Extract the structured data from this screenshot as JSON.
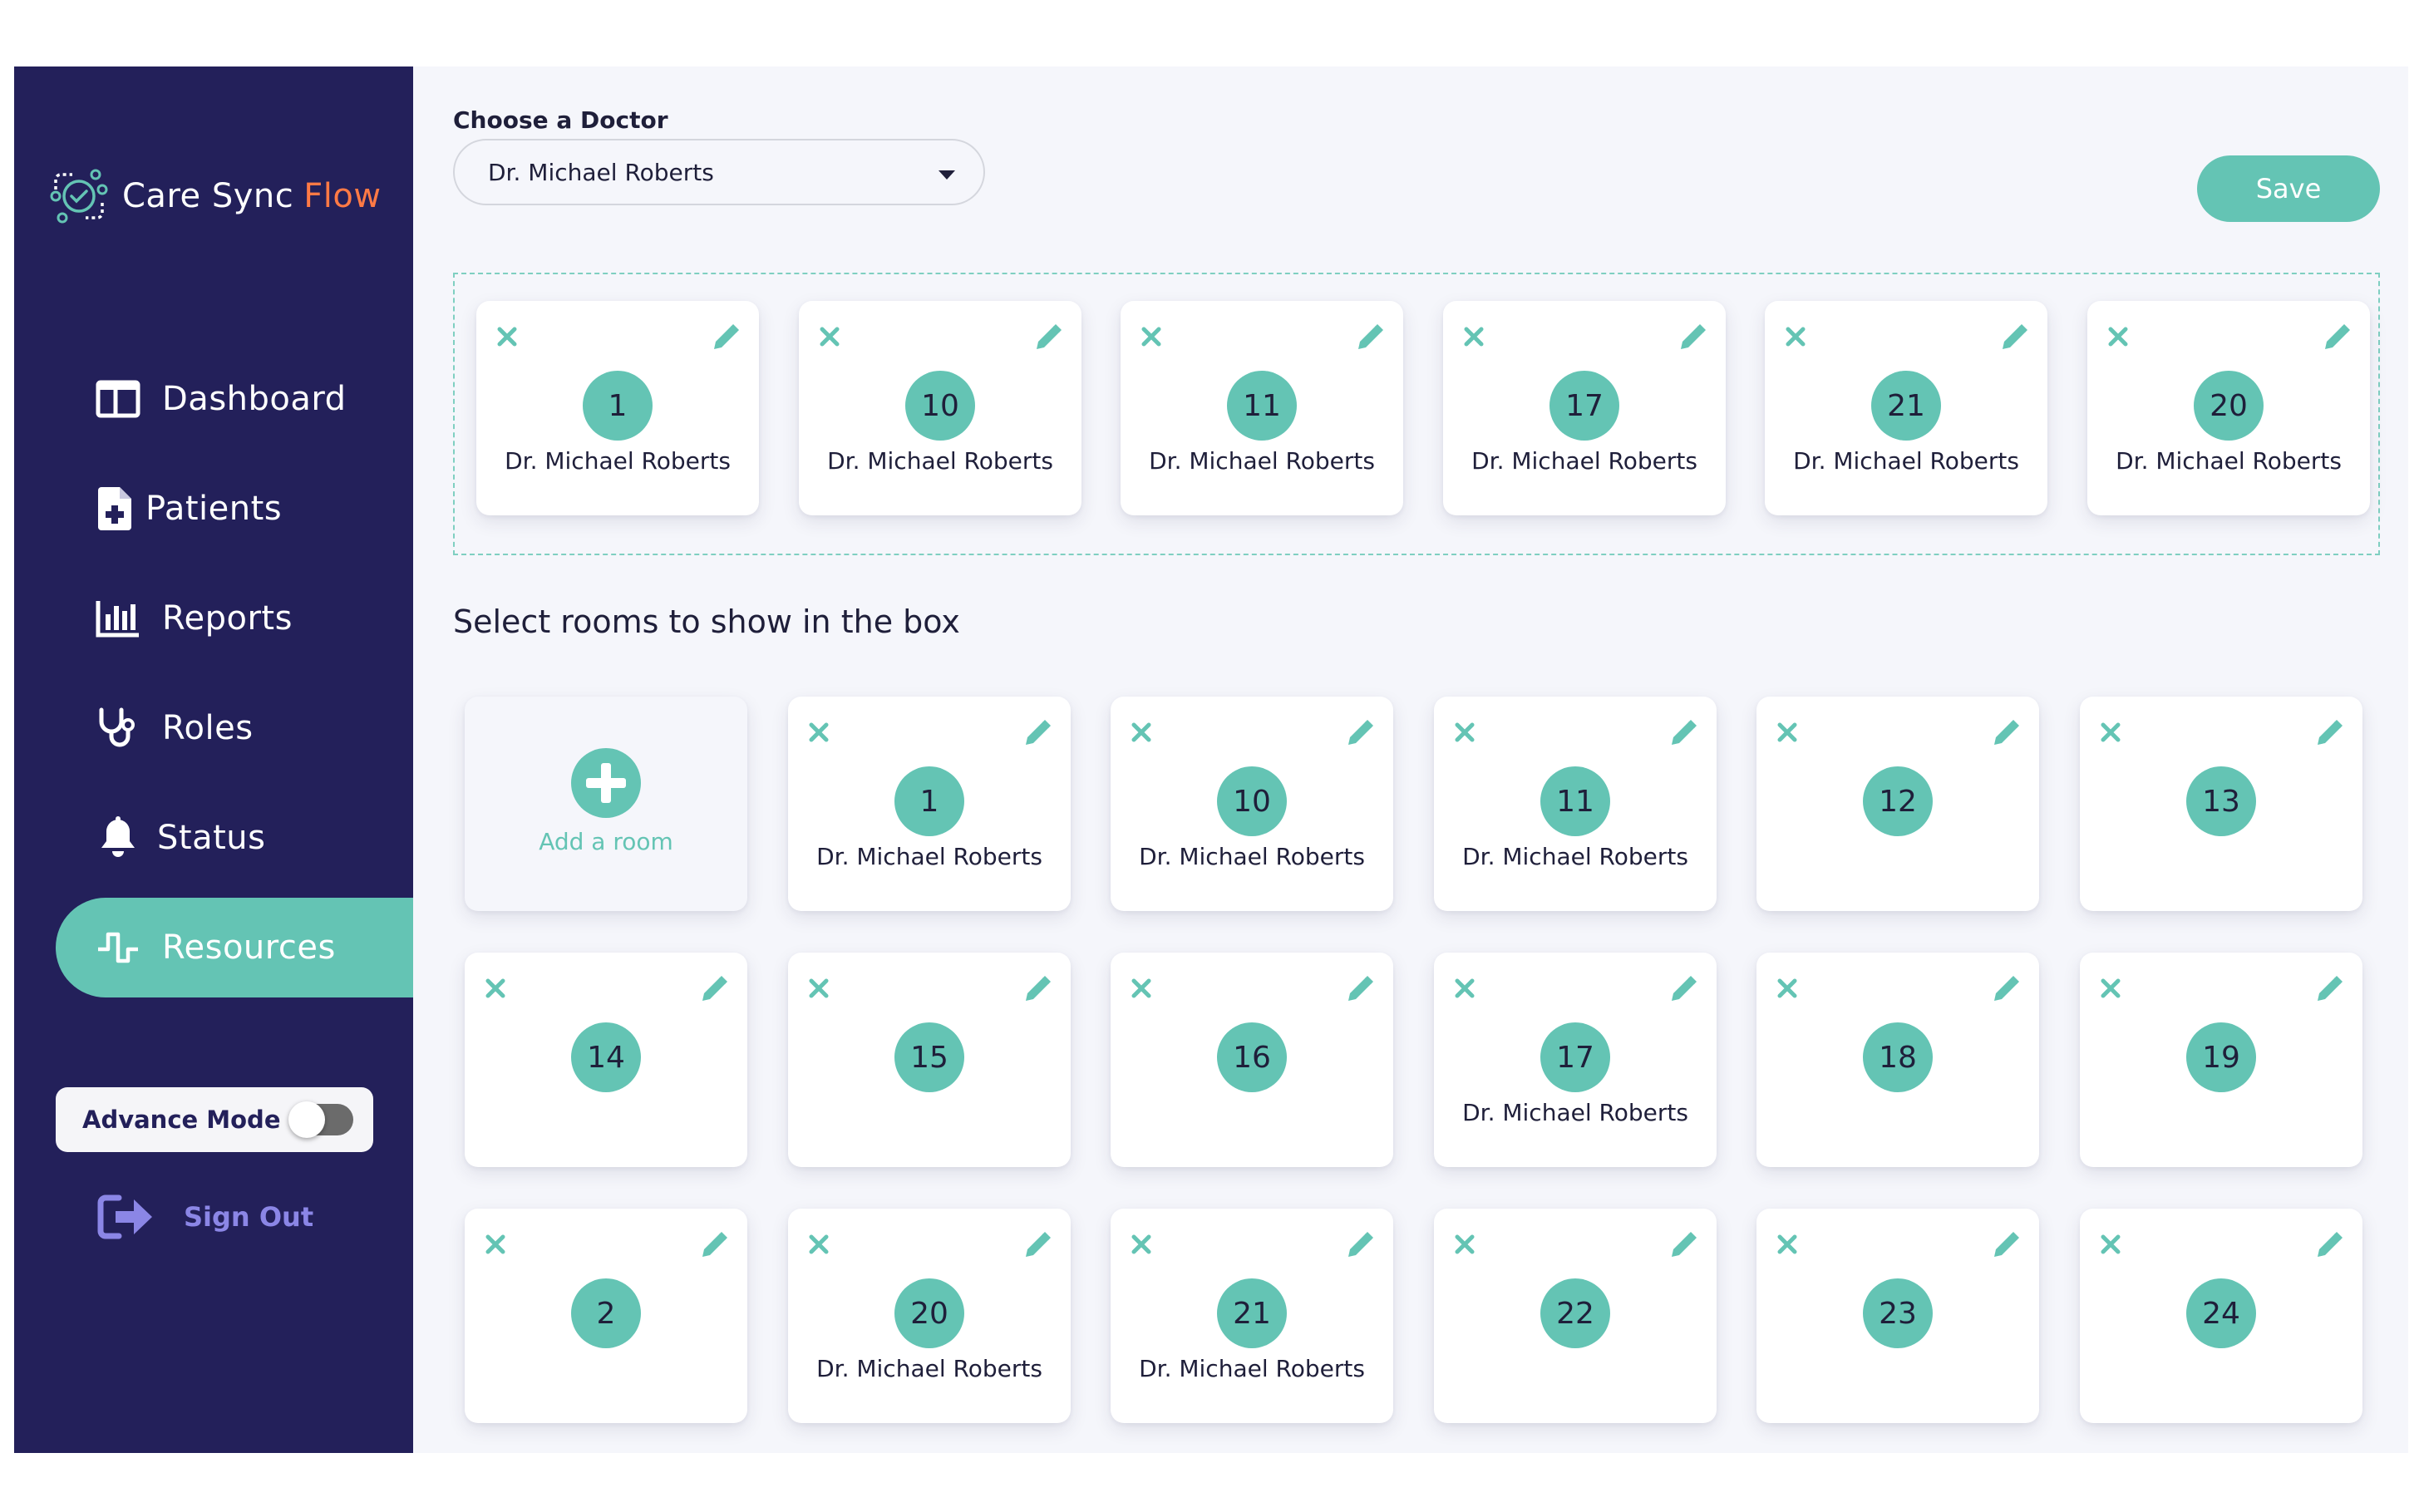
{
  "brand": {
    "name_part1": "Care Sync",
    "name_part2": "Flow"
  },
  "sidebar": {
    "items": [
      {
        "label": "Dashboard",
        "icon": "dashboard-icon"
      },
      {
        "label": "Patients",
        "icon": "patient-file-icon"
      },
      {
        "label": "Reports",
        "icon": "bar-chart-icon"
      },
      {
        "label": "Roles",
        "icon": "stethoscope-icon"
      },
      {
        "label": "Status",
        "icon": "bell-icon"
      },
      {
        "label": "Resources",
        "icon": "pulse-icon",
        "active": true
      }
    ],
    "advance_mode": {
      "label": "Advance Mode",
      "enabled": false
    },
    "sign_out": "Sign Out"
  },
  "header": {
    "doctor_label": "Choose a Doctor",
    "doctor_selected": "Dr. Michael Roberts",
    "save_label": "Save"
  },
  "selected_rooms": [
    {
      "number": "1",
      "doctor": "Dr. Michael Roberts"
    },
    {
      "number": "10",
      "doctor": "Dr. Michael Roberts"
    },
    {
      "number": "11",
      "doctor": "Dr. Michael Roberts"
    },
    {
      "number": "17",
      "doctor": "Dr. Michael Roberts"
    },
    {
      "number": "21",
      "doctor": "Dr. Michael Roberts"
    },
    {
      "number": "20",
      "doctor": "Dr. Michael Roberts"
    }
  ],
  "rooms_section_title": "Select rooms to show in the box",
  "add_room_label": "Add a room",
  "rooms": [
    {
      "number": "1",
      "doctor": "Dr. Michael Roberts"
    },
    {
      "number": "10",
      "doctor": "Dr. Michael Roberts"
    },
    {
      "number": "11",
      "doctor": "Dr. Michael Roberts"
    },
    {
      "number": "12",
      "doctor": ""
    },
    {
      "number": "13",
      "doctor": ""
    },
    {
      "number": "14",
      "doctor": ""
    },
    {
      "number": "15",
      "doctor": ""
    },
    {
      "number": "16",
      "doctor": ""
    },
    {
      "number": "17",
      "doctor": "Dr. Michael Roberts"
    },
    {
      "number": "18",
      "doctor": ""
    },
    {
      "number": "19",
      "doctor": ""
    },
    {
      "number": "2",
      "doctor": ""
    },
    {
      "number": "20",
      "doctor": "Dr. Michael Roberts"
    },
    {
      "number": "21",
      "doctor": "Dr. Michael Roberts"
    },
    {
      "number": "22",
      "doctor": ""
    },
    {
      "number": "23",
      "doctor": ""
    },
    {
      "number": "24",
      "doctor": ""
    }
  ],
  "colors": {
    "sidebar": "#23205a",
    "accent": "#64c4b4",
    "brand_orange": "#ff7a45",
    "sign_out": "#8b86e6"
  }
}
